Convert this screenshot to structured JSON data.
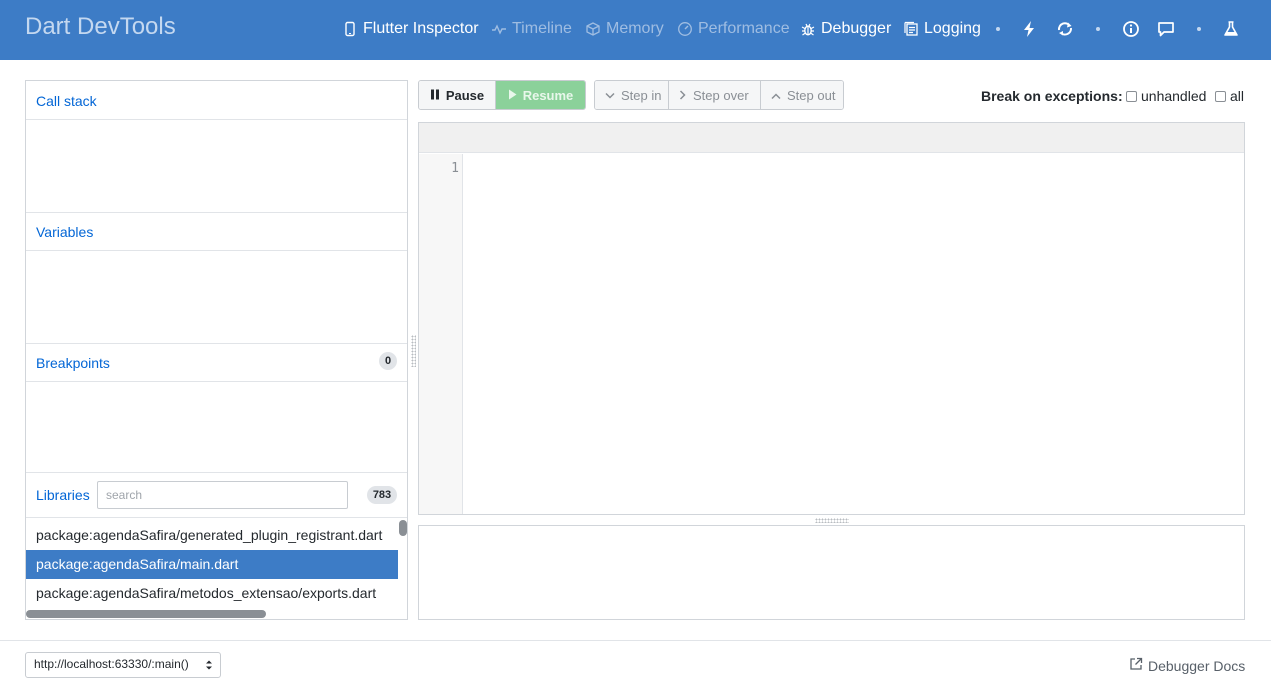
{
  "header": {
    "title": "Dart DevTools",
    "tabs": [
      {
        "label": "Flutter Inspector",
        "icon": "phone-icon",
        "state": "enabled"
      },
      {
        "label": "Timeline",
        "icon": "timeline-icon",
        "state": "disabled"
      },
      {
        "label": "Memory",
        "icon": "memory-icon",
        "state": "disabled"
      },
      {
        "label": "Performance",
        "icon": "performance-icon",
        "state": "disabled"
      },
      {
        "label": "Debugger",
        "icon": "bug-icon",
        "state": "active"
      },
      {
        "label": "Logging",
        "icon": "logging-icon",
        "state": "enabled"
      }
    ],
    "actions": [
      "hot-reload-icon",
      "hot-restart-icon",
      "info-icon",
      "feedback-icon",
      "flask-icon"
    ]
  },
  "sidebar": {
    "call_stack": {
      "title": "Call stack"
    },
    "variables": {
      "title": "Variables"
    },
    "breakpoints": {
      "title": "Breakpoints",
      "count": "0"
    },
    "libraries": {
      "title": "Libraries",
      "search_placeholder": "search",
      "count": "783",
      "items": [
        {
          "label": "package:agendaSafira/generated_plugin_registrant.dart",
          "selected": false
        },
        {
          "label": "package:agendaSafira/main.dart",
          "selected": true
        },
        {
          "label": "package:agendaSafira/metodos_extensao/exports.dart",
          "selected": false
        }
      ]
    }
  },
  "toolbar": {
    "pause_label": "Pause",
    "resume_label": "Resume",
    "step_in_label": "Step in",
    "step_over_label": "Step over",
    "step_out_label": "Step out",
    "break_on_exceptions_label": "Break on exceptions:",
    "unhandled_label": "unhandled",
    "all_label": "all"
  },
  "editor": {
    "line_numbers": [
      "1"
    ]
  },
  "footer": {
    "isolate_value": "http://localhost:63330/:main()",
    "docs_label": "Debugger Docs"
  },
  "colors": {
    "header_bg": "#3d7cc6",
    "link_blue": "#0366d6",
    "resume_green": "#8bd19a",
    "selected_row": "#3d7cc6"
  }
}
